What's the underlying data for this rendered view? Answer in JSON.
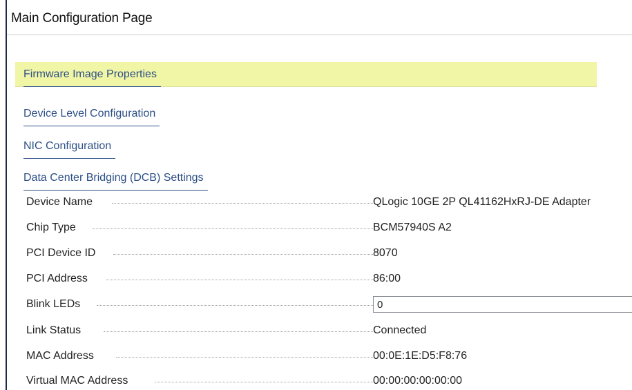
{
  "page": {
    "title": "Main Configuration Page"
  },
  "nav_links": [
    {
      "label": "Firmware Image Properties",
      "selected": true
    },
    {
      "label": "Device Level Configuration",
      "selected": false
    },
    {
      "label": "NIC Configuration",
      "selected": false
    },
    {
      "label": "Data Center Bridging (DCB) Settings",
      "selected": false
    }
  ],
  "fields": {
    "device_name": {
      "label": "Device Name",
      "value": "QLogic 10GE 2P QL41162HxRJ-DE Adapter"
    },
    "chip_type": {
      "label": "Chip Type",
      "value": "BCM57940S A2"
    },
    "pci_device_id": {
      "label": "PCI Device ID",
      "value": "8070"
    },
    "pci_address": {
      "label": "PCI Address",
      "value": "86:00"
    },
    "blink_leds": {
      "label": "Blink LEDs",
      "value": "0"
    },
    "link_status": {
      "label": "Link Status",
      "value": "Connected"
    },
    "mac_address": {
      "label": "MAC Address",
      "value": "00:0E:1E:D5:F8:76"
    },
    "virtual_mac_address": {
      "label": "Virtual MAC Address",
      "value": "00:00:00:00:00:00"
    }
  },
  "colors": {
    "link": "#2c4f86",
    "selected_highlight": "#f1f5a6",
    "frame_border": "#1f2a44"
  }
}
